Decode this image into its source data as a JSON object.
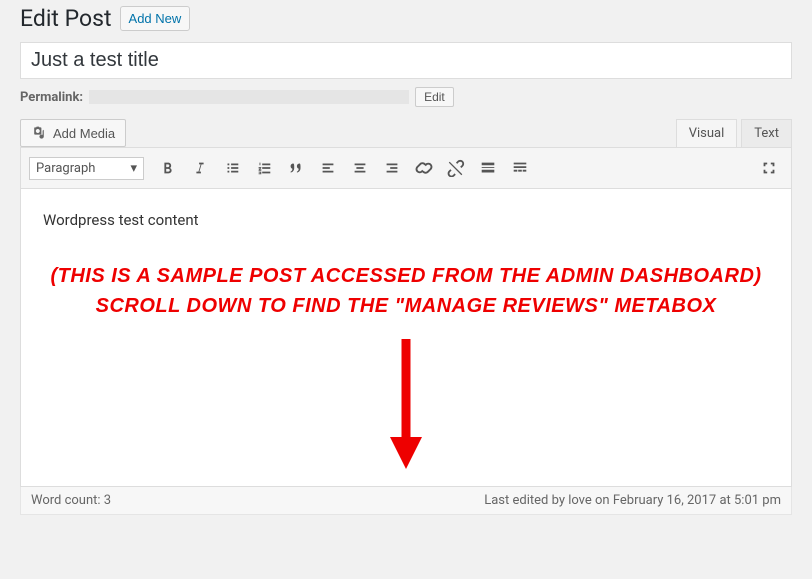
{
  "header": {
    "title": "Edit Post",
    "add_new": "Add New"
  },
  "post": {
    "title": "Just a test title",
    "content": "Wordpress test content"
  },
  "permalink": {
    "label": "Permalink:",
    "edit": "Edit"
  },
  "media": {
    "add_media": "Add Media"
  },
  "tabs": {
    "visual": "Visual",
    "text": "Text"
  },
  "toolbar": {
    "format": "Paragraph"
  },
  "annotation": {
    "line1": "(This is a sample post accessed from the admin dashboard)",
    "line2": "Scroll down to find the \"Manage Reviews\" metabox"
  },
  "status": {
    "word_count_label": "Word count: 3",
    "last_edited": "Last edited by love on February 16, 2017 at 5:01 pm"
  }
}
